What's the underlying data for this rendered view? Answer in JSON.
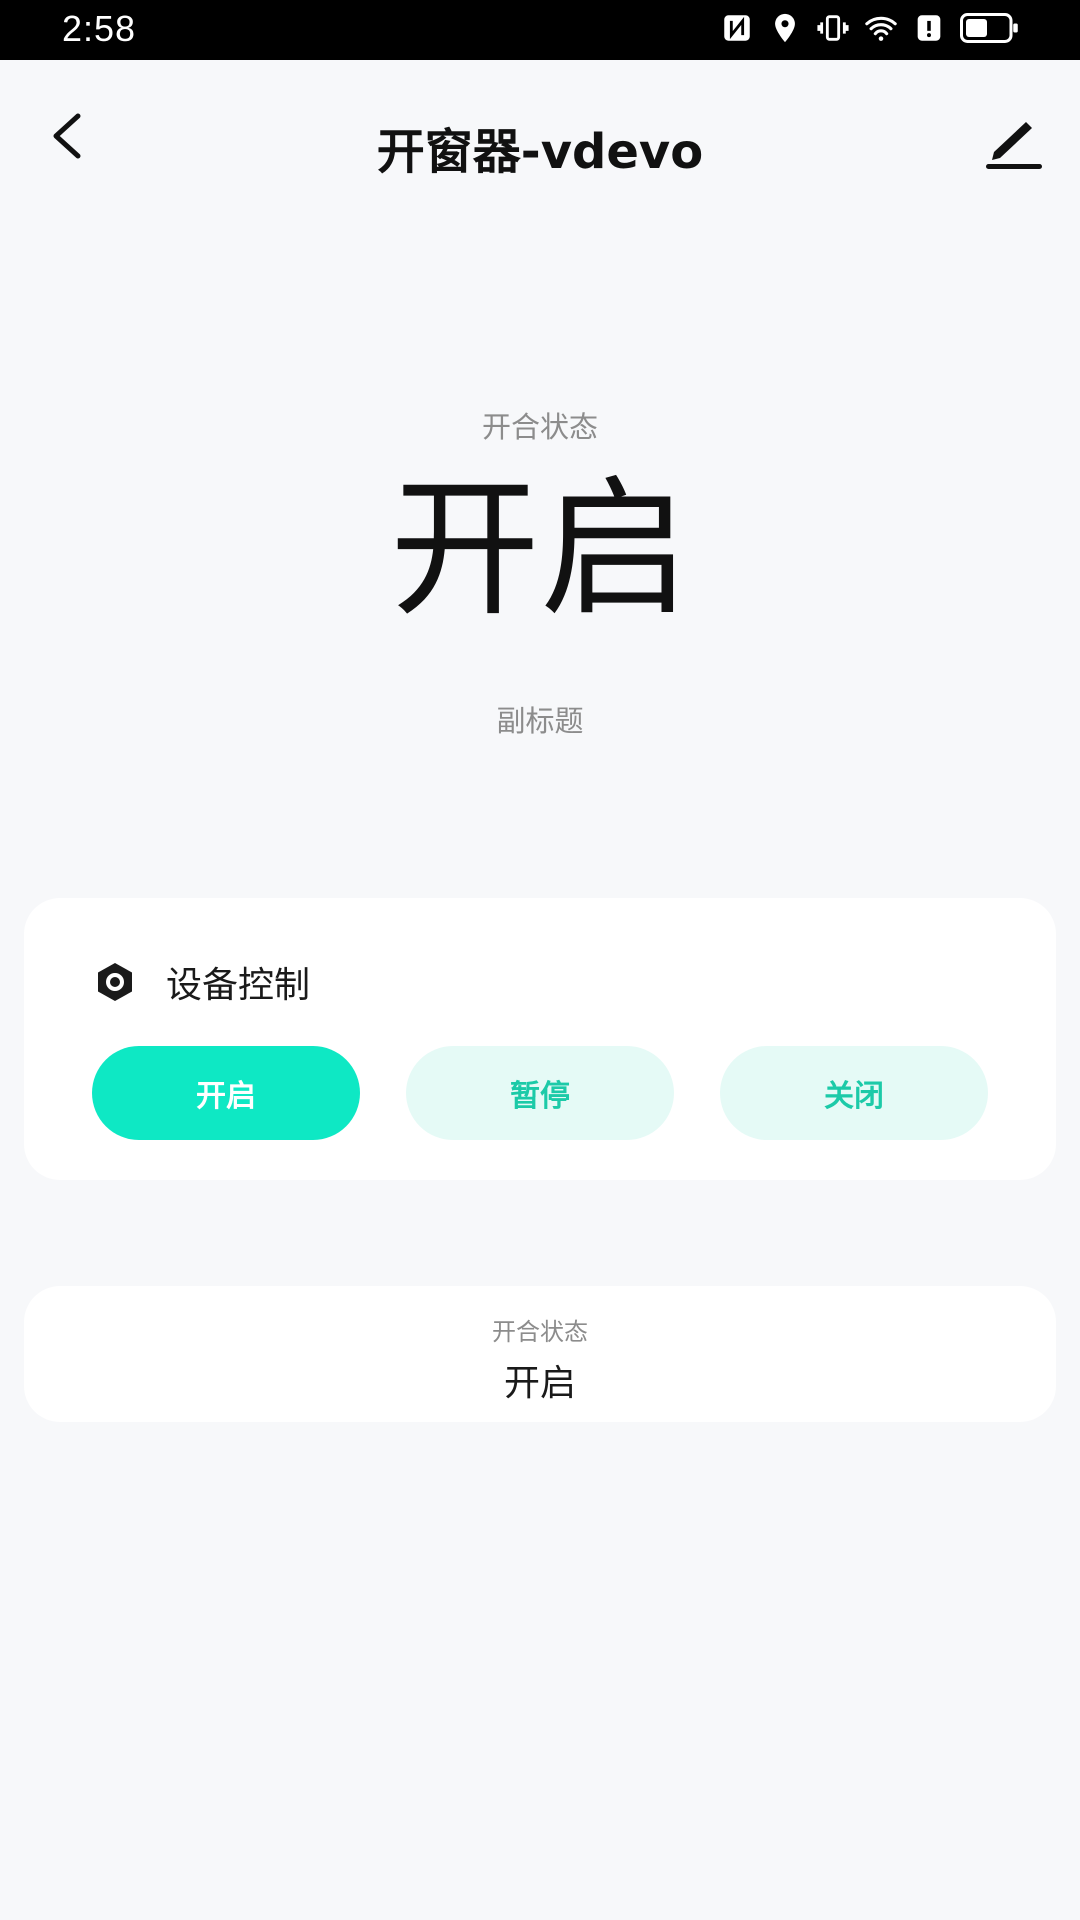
{
  "status_bar": {
    "time": "2:58",
    "icons": [
      "nfc-icon",
      "location-icon",
      "vibrate-icon",
      "wifi-icon",
      "alert-icon",
      "battery-icon"
    ]
  },
  "nav": {
    "title": "开窗器-vdevo",
    "back_icon": "back-arrow-icon",
    "edit_icon": "edit-pencil-icon"
  },
  "hero": {
    "label": "开合状态",
    "value": "开启",
    "subtitle": "副标题"
  },
  "control_card": {
    "title": "设备控制",
    "icon": "hexagon-nut-icon",
    "buttons": [
      {
        "label": "开启",
        "state": "active"
      },
      {
        "label": "暂停",
        "state": "idle"
      },
      {
        "label": "关闭",
        "state": "idle"
      }
    ]
  },
  "status_card": {
    "label": "开合状态",
    "value": "开启"
  },
  "colors": {
    "accent": "#0ee8c4",
    "accent_light": "#e5faf6",
    "accent_text": "#1ccaa8",
    "background": "#f7f8fa"
  }
}
